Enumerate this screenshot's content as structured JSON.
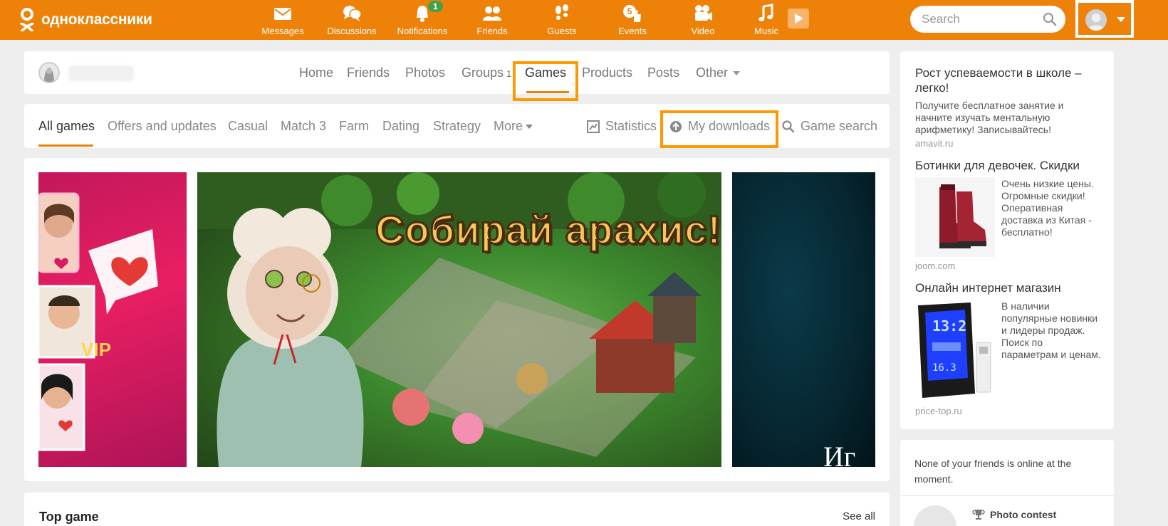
{
  "header": {
    "brand": "одноклассники",
    "nav": [
      {
        "id": "messages",
        "label": "Messages",
        "icon": "envelope-icon"
      },
      {
        "id": "discussions",
        "label": "Discussions",
        "icon": "speech-bubbles-icon"
      },
      {
        "id": "notifications",
        "label": "Notifications",
        "icon": "bell-icon",
        "badge": "1"
      },
      {
        "id": "friends",
        "label": "Friends",
        "icon": "people-icon"
      },
      {
        "id": "guests",
        "label": "Guests",
        "icon": "footprints-icon"
      },
      {
        "id": "events",
        "label": "Events",
        "icon": "thumbs-up-icon",
        "badge": "5"
      },
      {
        "id": "video",
        "label": "Video",
        "icon": "camera-icon"
      },
      {
        "id": "music",
        "label": "Music",
        "icon": "music-note-icon"
      }
    ],
    "search": {
      "placeholder": "Search"
    },
    "accent_color": "#ee8208"
  },
  "profile_tabs": {
    "items": [
      {
        "label": "Home"
      },
      {
        "label": "Friends"
      },
      {
        "label": "Photos"
      },
      {
        "label": "Groups",
        "count": "1"
      },
      {
        "label": "Games",
        "active": true
      },
      {
        "label": "Products"
      },
      {
        "label": "Posts"
      },
      {
        "label": "Other"
      }
    ]
  },
  "games_tabs": {
    "items": [
      {
        "label": "All games",
        "active": true
      },
      {
        "label": "Offers and updates"
      },
      {
        "label": "Casual"
      },
      {
        "label": "Match 3"
      },
      {
        "label": "Farm"
      },
      {
        "label": "Dating"
      },
      {
        "label": "Strategy"
      },
      {
        "label": "More"
      }
    ],
    "actions": [
      {
        "label": "Statistics",
        "icon": "bar-chart-icon"
      },
      {
        "label": "My downloads",
        "icon": "upload-circle-icon"
      },
      {
        "label": "Game search",
        "icon": "magnifier-icon"
      }
    ]
  },
  "banner": {
    "main_title": "Собирай арахис!",
    "right_text": "Иг"
  },
  "top_game": {
    "title": "Top game",
    "see_all": "See all"
  },
  "ads": [
    {
      "title": "Рост успеваемости в школе – легко!",
      "text": "Получите бесплатное занятие и начните изучать ментальную арифметику! Записывайтесь!",
      "source": "amavit.ru"
    },
    {
      "title": "Ботинки для девочек. Скидки",
      "text": "Очень низкие цены. Огромные скидки! Оперативная доставка из Китая - бесплатно!",
      "source": "joom.com"
    },
    {
      "title": "Онлайн интернет магазин",
      "text": "В наличии популярные новинки и лидеры продаж. Поиск по параметрам и ценам.",
      "source": "price-top.ru"
    }
  ],
  "friends_panel": {
    "message": "None of your friends is online at the moment.",
    "contest_label": "Photo contest"
  }
}
